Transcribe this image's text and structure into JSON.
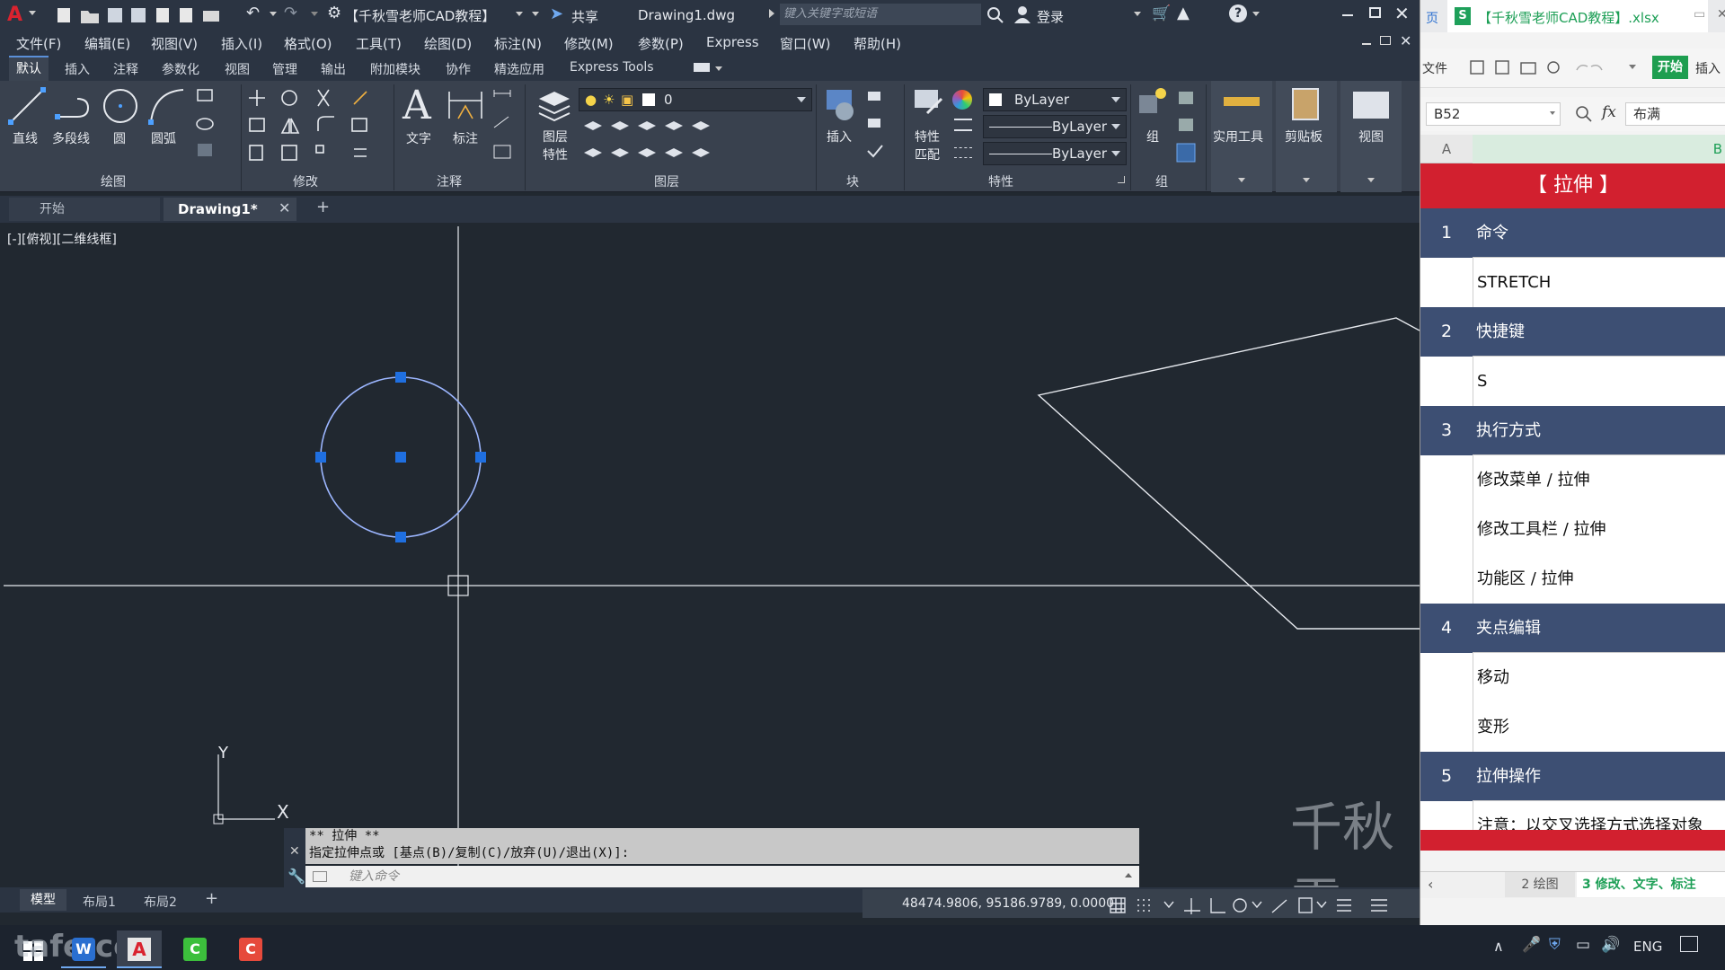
{
  "cad": {
    "title_bar": {
      "workspace": "【千秋雪老师CAD教程】",
      "share_label": "共享",
      "filename": "Drawing1.dwg",
      "search_placeholder": "键入关键字或短语",
      "login_label": "登录"
    },
    "menu": [
      "文件(F)",
      "编辑(E)",
      "视图(V)",
      "插入(I)",
      "格式(O)",
      "工具(T)",
      "绘图(D)",
      "标注(N)",
      "修改(M)",
      "参数(P)",
      "Express",
      "窗口(W)",
      "帮助(H)"
    ],
    "ribbon_tabs": [
      "默认",
      "插入",
      "注释",
      "参数化",
      "视图",
      "管理",
      "输出",
      "附加模块",
      "协作",
      "精选应用",
      "Express Tools"
    ],
    "ribbon": {
      "draw_tools": {
        "line": "直线",
        "polyline": "多段线",
        "circle": "圆",
        "arc": "圆弧"
      },
      "text_tools": {
        "text": "文字",
        "dimension": "标注"
      },
      "layer_tools": {
        "layer_props_line1": "图层",
        "layer_props_line2": "特性",
        "current_layer": "0"
      },
      "block_tools": {
        "insert": "插入"
      },
      "props_tools": {
        "match_line1": "特性",
        "match_line2": "匹配",
        "color": "ByLayer",
        "linetype": "ByLayer",
        "lineweight": "ByLayer"
      },
      "group_tools": {
        "group": "组"
      },
      "utilities": "实用工具",
      "clipboard": "剪贴板",
      "view": "视图",
      "panels": {
        "draw": "绘图",
        "modify": "修改",
        "annotate": "注释",
        "layers": "图层",
        "block": "块",
        "properties": "特性",
        "groups": "组"
      }
    },
    "doc_tabs": {
      "start": "开始",
      "active": "Drawing1*"
    },
    "viewport_label": "[-][俯视][二维线框]",
    "ucs": {
      "x": "X",
      "y": "Y"
    },
    "watermark": "千秋雪",
    "command": {
      "line1": "** 拉伸 **",
      "line2": "指定拉伸点或 [基点(B)/复制(C)/放弃(U)/退出(X)]:",
      "input_placeholder": "键入命令"
    },
    "layout_tabs": [
      "模型",
      "布局1",
      "布局2"
    ],
    "status": {
      "coords": "48474.9806, 95186.9789, 0.0000"
    }
  },
  "sheet": {
    "tab_prefix": "页",
    "file_tab": "【千秋雪老师CAD教程】.xlsx",
    "toolbar": {
      "file": "文件",
      "start": "开始",
      "insert": "插入"
    },
    "name_box": "B52",
    "fx": "fx",
    "format_label": "布满",
    "col_a": "A",
    "col_b": "B",
    "title": "【 拉伸 】",
    "rows": [
      {
        "num": "1",
        "text": "命令",
        "head": true
      },
      {
        "num": "",
        "text": "STRETCH",
        "head": false
      },
      {
        "num": "2",
        "text": "快捷键",
        "head": true
      },
      {
        "num": "",
        "text": "S",
        "head": false
      },
      {
        "num": "3",
        "text": "执行方式",
        "head": true
      },
      {
        "num": "",
        "text": "修改菜单 / 拉伸",
        "head": false
      },
      {
        "num": "",
        "text": "修改工具栏 / 拉伸",
        "head": false
      },
      {
        "num": "",
        "text": "功能区 / 拉伸",
        "head": false
      },
      {
        "num": "4",
        "text": "夹点编辑",
        "head": true
      },
      {
        "num": "",
        "text": "移动",
        "head": false
      },
      {
        "num": "",
        "text": "变形",
        "head": false
      },
      {
        "num": "5",
        "text": "拉伸操作",
        "head": true
      },
      {
        "num": "",
        "text": "注意：以交叉选择方式选择对象",
        "head": false
      }
    ],
    "bottom_tabs": {
      "t1": "2 绘图",
      "t2": "3 修改、文字、标注"
    }
  },
  "taskbar": {
    "language": "ENG",
    "watermark": "tafe.cc"
  }
}
